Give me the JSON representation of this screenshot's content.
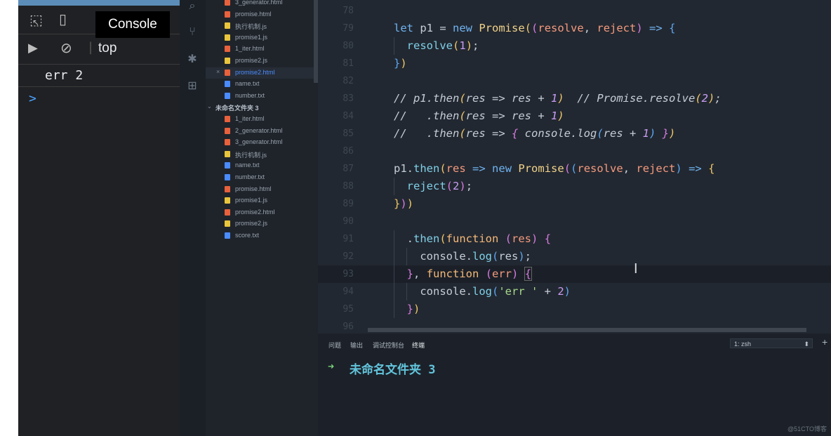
{
  "devtools": {
    "console_tab": "Console",
    "context": "top",
    "log_line": "err 2",
    "prompt_symbol": ">"
  },
  "activity_icons": [
    "search-icon",
    "source-control-icon",
    "debug-icon",
    "extensions-icon"
  ],
  "explorer": {
    "items_top": [
      {
        "name": "3_generator.html",
        "type": "html"
      },
      {
        "name": "promise.html",
        "type": "html"
      },
      {
        "name": "执行机制.js",
        "type": "js"
      },
      {
        "name": "promise1.js",
        "type": "js"
      },
      {
        "name": "1_iter.html",
        "type": "html"
      },
      {
        "name": "promise2.js",
        "type": "js"
      },
      {
        "name": "promise2.html",
        "type": "html",
        "active": true
      },
      {
        "name": "name.txt",
        "type": "txt"
      },
      {
        "name": "number.txt",
        "type": "txt"
      }
    ],
    "folder": "未命名文件夹 3",
    "items_folder": [
      {
        "name": "1_iter.html",
        "type": "html"
      },
      {
        "name": "2_generator.html",
        "type": "html"
      },
      {
        "name": "3_generator.html",
        "type": "html"
      },
      {
        "name": "执行机制.js",
        "type": "js"
      },
      {
        "name": "name.txt",
        "type": "txt"
      },
      {
        "name": "number.txt",
        "type": "txt"
      },
      {
        "name": "promise.html",
        "type": "html"
      },
      {
        "name": "promise1.js",
        "type": "js"
      },
      {
        "name": "promise2.html",
        "type": "html"
      },
      {
        "name": "promise2.js",
        "type": "js"
      },
      {
        "name": "score.txt",
        "type": "txt"
      }
    ]
  },
  "editor": {
    "line_numbers": [
      "78",
      "79",
      "80",
      "81",
      "82",
      "83",
      "84",
      "85",
      "86",
      "87",
      "88",
      "89",
      "90",
      "91",
      "92",
      "93",
      "94",
      "95",
      "96"
    ],
    "current_line": "93"
  },
  "panel": {
    "tabs": [
      "问题",
      "输出",
      "调试控制台",
      "终端"
    ],
    "terminal_select": "1: zsh",
    "prompt_arrow": "➜",
    "cwd": "未命名文件夹 3",
    "add": "+"
  },
  "watermark": "@51CTO博客",
  "colors": {
    "html_icon": "#e8613c",
    "js_icon": "#e9c53c",
    "txt_icon": "#4a8cff"
  }
}
